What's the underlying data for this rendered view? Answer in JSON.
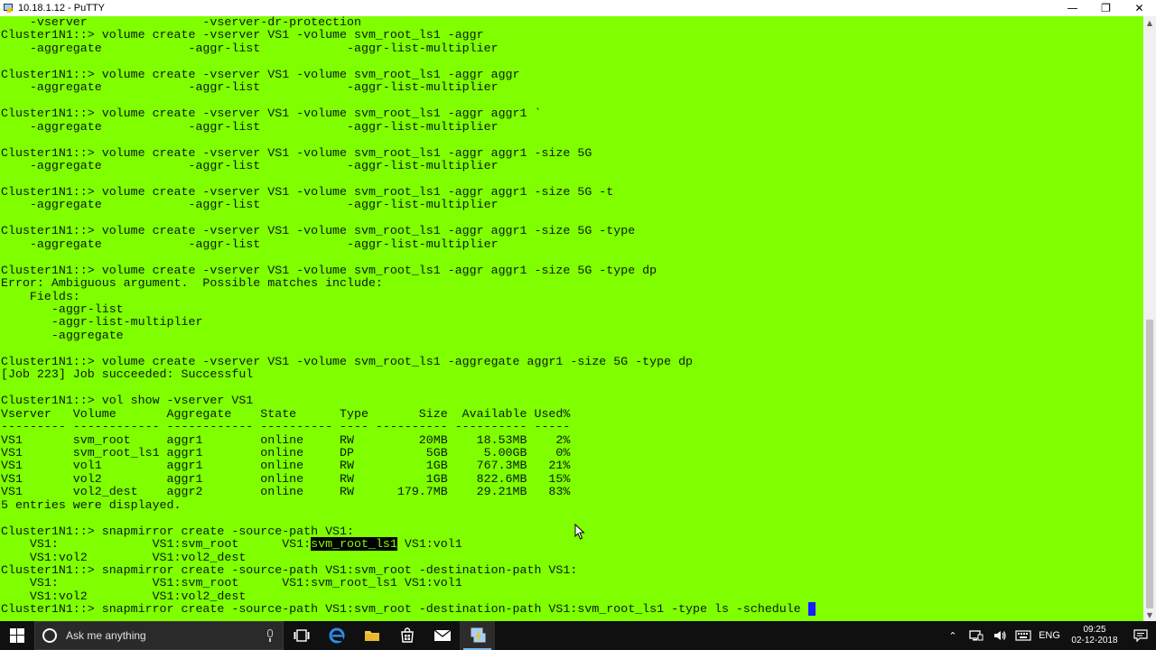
{
  "window": {
    "title": "10.18.1.12 - PuTTY",
    "minimize_glyph": "—",
    "restore_glyph": "❐",
    "close_glyph": "✕"
  },
  "terminal": {
    "lines_before_highlight": "    -vserver                -vserver-dr-protection\nCluster1N1::> volume create -vserver VS1 -volume svm_root_ls1 -aggr\n    -aggregate            -aggr-list            -aggr-list-multiplier\n\nCluster1N1::> volume create -vserver VS1 -volume svm_root_ls1 -aggr aggr\n    -aggregate            -aggr-list            -aggr-list-multiplier\n\nCluster1N1::> volume create -vserver VS1 -volume svm_root_ls1 -aggr aggr1 `\n    -aggregate            -aggr-list            -aggr-list-multiplier\n\nCluster1N1::> volume create -vserver VS1 -volume svm_root_ls1 -aggr aggr1 -size 5G\n    -aggregate            -aggr-list            -aggr-list-multiplier\n\nCluster1N1::> volume create -vserver VS1 -volume svm_root_ls1 -aggr aggr1 -size 5G -t\n    -aggregate            -aggr-list            -aggr-list-multiplier\n\nCluster1N1::> volume create -vserver VS1 -volume svm_root_ls1 -aggr aggr1 -size 5G -type\n    -aggregate            -aggr-list            -aggr-list-multiplier\n\nCluster1N1::> volume create -vserver VS1 -volume svm_root_ls1 -aggr aggr1 -size 5G -type dp\nError: Ambiguous argument.  Possible matches include:\n    Fields:\n       -aggr-list\n       -aggr-list-multiplier\n       -aggregate\n\nCluster1N1::> volume create -vserver VS1 -volume svm_root_ls1 -aggregate aggr1 -size 5G -type dp\n[Job 223] Job succeeded: Successful\n\nCluster1N1::> vol show -vserver VS1\nVserver   Volume       Aggregate    State      Type       Size  Available Used%\n--------- ------------ ------------ ---------- ---- ---------- ---------- -----\nVS1       svm_root     aggr1        online     RW         20MB    18.53MB    2%\nVS1       svm_root_ls1 aggr1        online     DP          5GB     5.00GB    0%\nVS1       vol1         aggr1        online     RW          1GB    767.3MB   21%\nVS1       vol2         aggr1        online     RW          1GB    822.6MB   15%\nVS1       vol2_dest    aggr2        online     RW      179.7MB    29.21MB   83%\n5 entries were displayed.\n\nCluster1N1::> snapmirror create -source-path VS1:\n    VS1:             VS1:svm_root      VS1:",
    "highlighted_text": "svm_root_ls1",
    "lines_after_highlight": " VS1:vol1\n    VS1:vol2         VS1:vol2_dest\nCluster1N1::> snapmirror create -source-path VS1:svm_root -destination-path VS1:\n    VS1:             VS1:svm_root      VS1:svm_root_ls1 VS1:vol1\n    VS1:vol2         VS1:vol2_dest\nCluster1N1::> snapmirror create -source-path VS1:svm_root -destination-path VS1:svm_root_ls1 -type ls -schedule ",
    "cursor_char": " ",
    "colors": {
      "background": "#7fff00",
      "text": "#0a1a0a",
      "cursor": "#1a1aff"
    }
  },
  "taskbar": {
    "search_placeholder": "Ask me anything",
    "apps": [
      {
        "name": "task-view",
        "icon": "task-view-icon"
      },
      {
        "name": "edge",
        "icon": "edge-icon"
      },
      {
        "name": "file-explorer",
        "icon": "folder-icon"
      },
      {
        "name": "store",
        "icon": "store-icon"
      },
      {
        "name": "mail",
        "icon": "mail-icon"
      },
      {
        "name": "putty",
        "icon": "putty-icon",
        "active": true
      }
    ],
    "tray": {
      "language": "ENG",
      "time": "09:25",
      "date": "02-12-2018"
    }
  }
}
